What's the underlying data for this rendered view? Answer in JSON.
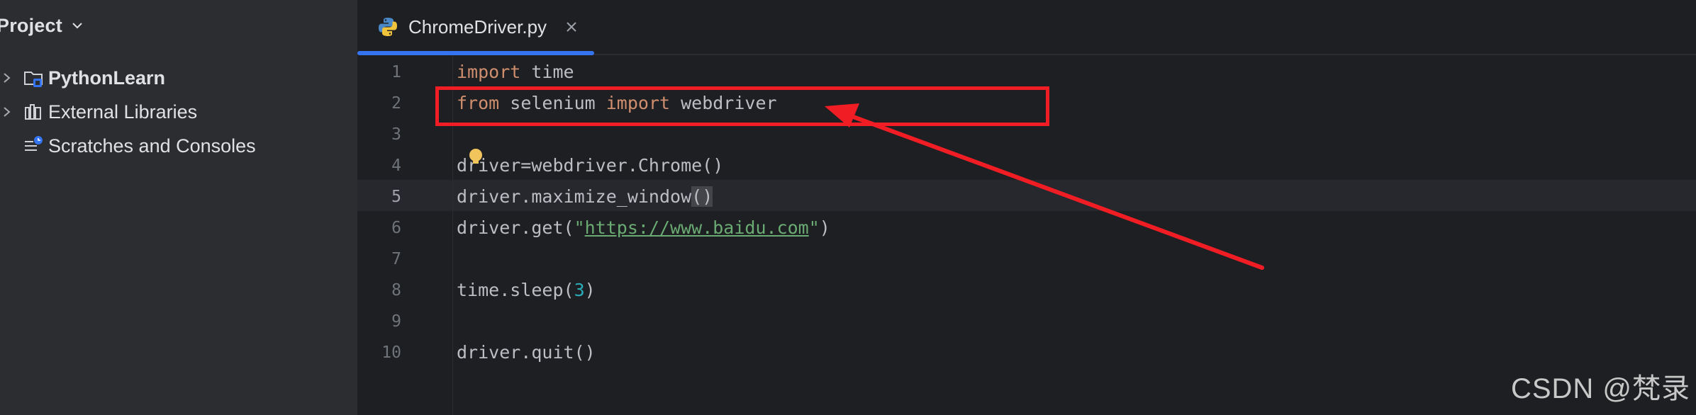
{
  "sidebar": {
    "title": "Project",
    "items": [
      {
        "label": "PythonLearn",
        "icon": "folder-module-icon"
      },
      {
        "label": "External Libraries",
        "icon": "library-icon"
      },
      {
        "label": "Scratches and Consoles",
        "icon": "scratches-icon"
      }
    ]
  },
  "editor": {
    "tab": {
      "label": "ChromeDriver.py",
      "icon": "python-file-icon"
    },
    "line_numbers": [
      "1",
      "2",
      "3",
      "4",
      "5",
      "6",
      "7",
      "8",
      "9",
      "10"
    ],
    "current_line": "5",
    "code": {
      "l1_kw": "import",
      "l1_rest": " time",
      "l2_kw1": "from",
      "l2_mid": " selenium ",
      "l2_kw2": "import",
      "l2_rest": " webdriver",
      "l4": "driver=webdriver.Chrome()",
      "l5_main": "driver.maximize_window",
      "l5_parens": "()",
      "l6_pre": "driver.get(",
      "l6_q1": "\"",
      "l6_url": "https://www.baidu.com",
      "l6_q2": "\"",
      "l6_post": ")",
      "l8_pre": "time.sleep(",
      "l8_num": "3",
      "l8_post": ")",
      "l10": "driver.quit()"
    }
  },
  "watermark": "CSDN @梵录",
  "colors": {
    "annotation": "#f11d25",
    "accent": "#3574f0"
  }
}
